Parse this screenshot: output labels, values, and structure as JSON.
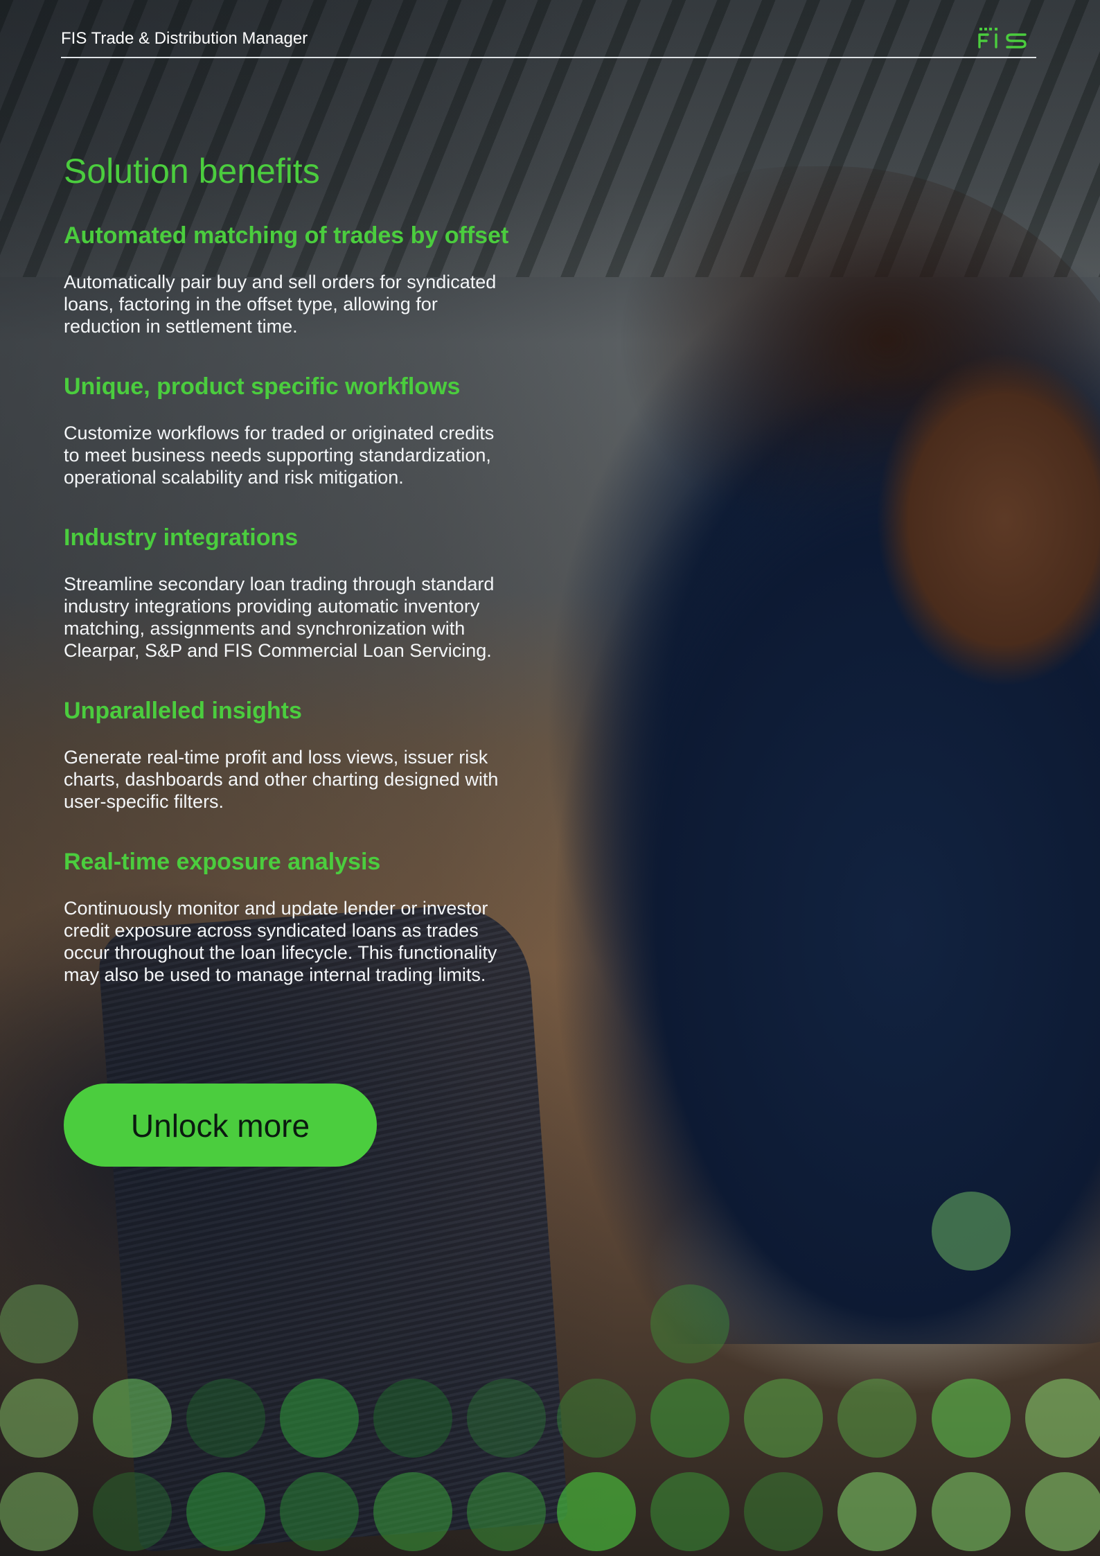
{
  "header": {
    "title": "FIS Trade & Distribution Manager",
    "logo_text": "FIS",
    "logo_icon": "fis-logo-icon"
  },
  "main": {
    "title": "Solution benefits",
    "benefits": [
      {
        "heading": "Automated matching of trades by offset",
        "lines": [
          "Automatically pair buy and sell orders for syndicated",
          "loans, factoring in the offset type, allowing for",
          "reduction in settlement time."
        ]
      },
      {
        "heading": "Unique, product specific workflows",
        "lines": [
          "Customize workflows for traded or originated credits",
          "to meet business needs supporting standardization,",
          "operational scalability and risk mitigation."
        ]
      },
      {
        "heading": "Industry integrations",
        "lines": [
          "Streamline secondary loan trading through standard",
          "industry integrations providing automatic inventory",
          "matching, assignments and synchronization with",
          "Clearpar, S&P and FIS Commercial Loan Servicing."
        ]
      },
      {
        "heading": "Unparalleled insights",
        "lines": [
          "Generate real-time profit and loss views, issuer risk",
          "charts, dashboards and other charting designed with",
          "user-specific filters."
        ]
      },
      {
        "heading": "Real-time exposure analysis",
        "lines": [
          "Continuously monitor and update lender or investor",
          "credit exposure across syndicated loans as trades",
          "occur throughout the loan lifecycle. This functionality",
          "may also be used to manage internal trading limits."
        ]
      }
    ],
    "cta_label": "Unlock more"
  },
  "colors": {
    "brand_green": "#4bcd3e",
    "text_light": "#f4f6f8",
    "rule": "#dfe3e6"
  }
}
